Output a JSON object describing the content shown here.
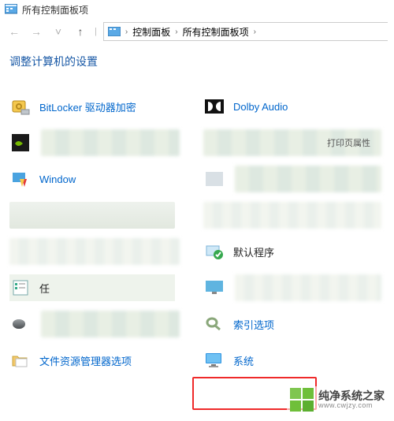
{
  "window": {
    "title": "所有控制面板项"
  },
  "breadcrumb": {
    "root": "控制面板",
    "current": "所有控制面板项"
  },
  "subheader": {
    "title": "调整计算机的设置"
  },
  "items": {
    "bitlocker": "BitLocker 驱动器加密",
    "dolby": "Dolby Audio",
    "windows": "Window",
    "defaultprograms": "默认程序",
    "tasks": "任",
    "indexing": "索引选项",
    "explorer": "文件资源管理器选项",
    "system": "系统",
    "busprops": "打印页属性"
  },
  "watermark": {
    "name": "纯净系统之家",
    "url": "www.cwjzy.com"
  }
}
